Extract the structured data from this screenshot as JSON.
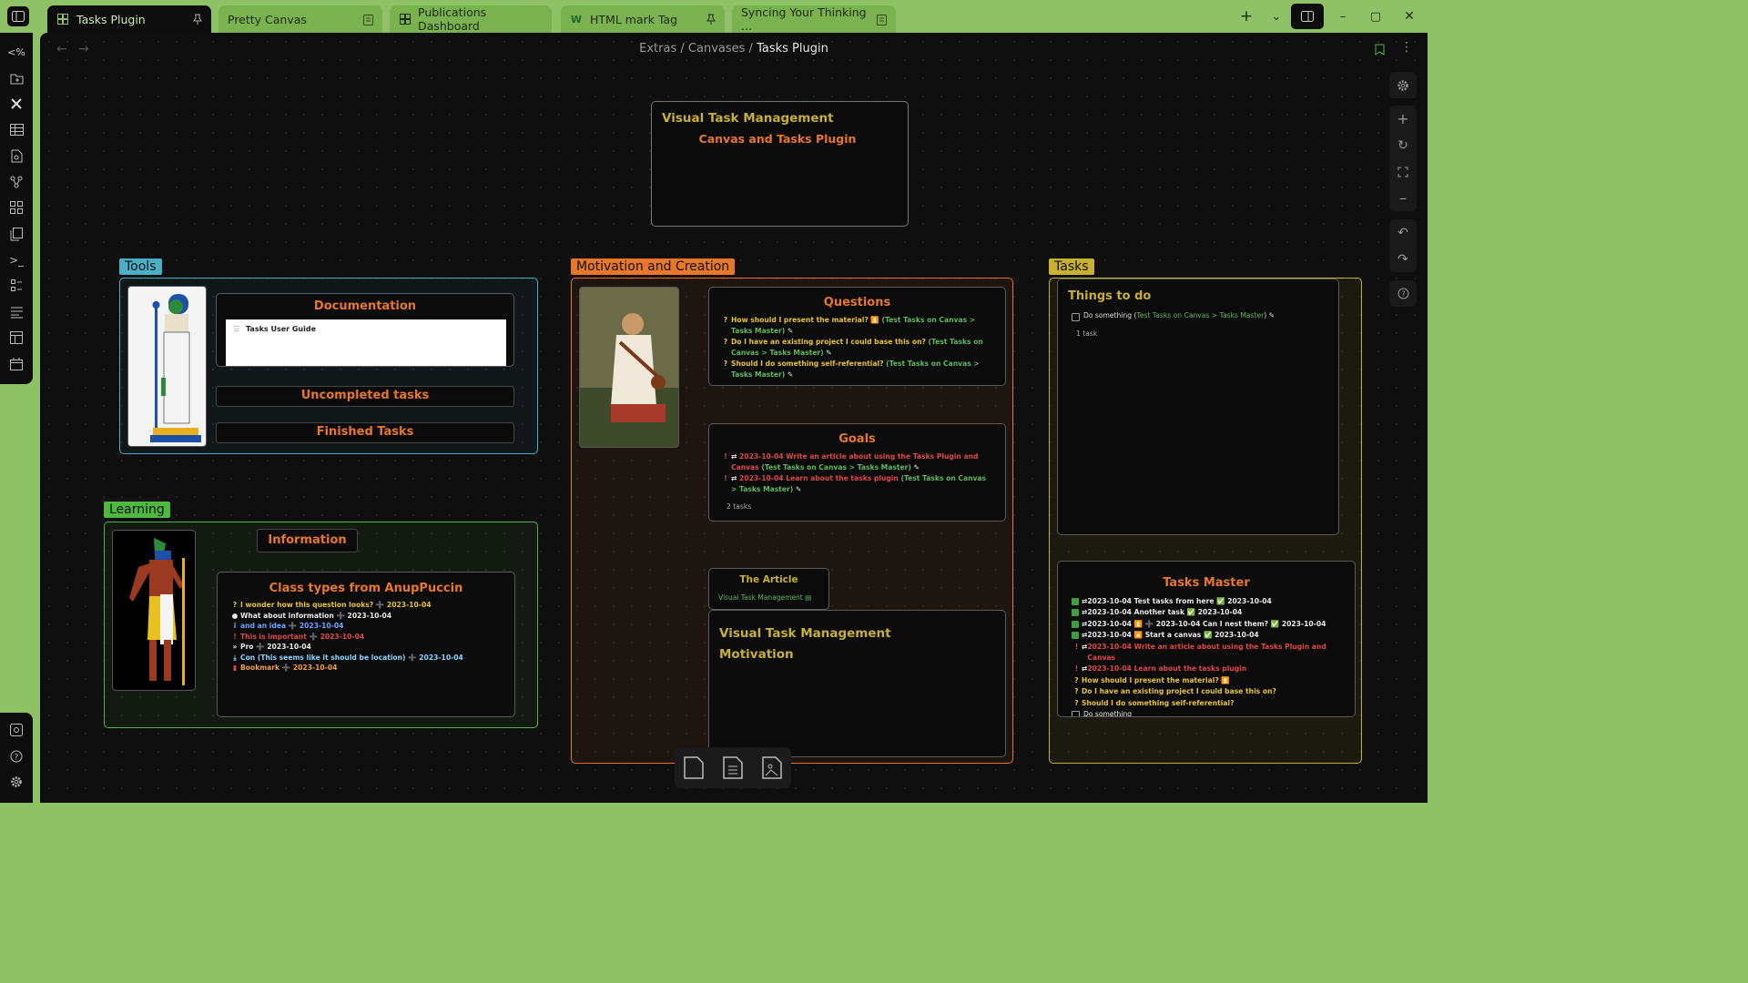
{
  "tabs": [
    {
      "label": "Tasks Plugin",
      "active": true,
      "pinned": true
    },
    {
      "label": "Pretty Canvas",
      "active": false
    },
    {
      "label": "Publications Dashboard",
      "active": false
    },
    {
      "label": "HTML mark Tag",
      "active": false,
      "pinned": true
    },
    {
      "label": "Syncing Your Thinking ...",
      "active": false
    }
  ],
  "breadcrumb": {
    "parts": [
      "Extras",
      "Canvases",
      "Tasks Plugin"
    ],
    "separator": "/"
  },
  "left_ribbon_top": [
    "percent-tag-icon",
    "open-folder-icon",
    "tools-icon",
    "table-icon",
    "file-search-icon",
    "graph-icon",
    "grid-icon",
    "files-icon",
    "terminal-icon",
    "list-icon",
    "sheet-icon",
    "layout-icon",
    "calendar-icon"
  ],
  "left_ribbon_bottom": [
    "vault-icon",
    "help-icon",
    "settings-icon"
  ],
  "canvas": {
    "title_card": {
      "title": "Visual Task Management",
      "subtitle": "Canvas and Tasks Plugin"
    },
    "tools": {
      "label": "Tools",
      "documentation": {
        "title": "Documentation",
        "embed_title": "Tasks User Guide"
      },
      "uncompleted": "Uncompleted tasks",
      "finished": "Finished Tasks"
    },
    "learning": {
      "label": "Learning",
      "information": "Information",
      "class_types": {
        "title": "Class types from AnupPuccin",
        "items": [
          {
            "icon": "?",
            "text": "I wonder how this question looks? ➕ 2023-10-04",
            "color": "yellow"
          },
          {
            "icon": "💡",
            "text": "What about information ➕ 2023-10-04",
            "color": "white"
          },
          {
            "icon": "i",
            "text": "and an idea ➕ 2023-10-04",
            "color": "blue"
          },
          {
            "icon": "!",
            "text": "This is important ➕ 2023-10-04",
            "color": "red"
          },
          {
            "icon": "»",
            "text": "Pro ➕ 2023-10-04",
            "color": "white"
          },
          {
            "icon": "⤓",
            "text": "Con (This seems like it should be location) ➕ 2023-10-04",
            "color": "lightblue"
          },
          {
            "icon": "🔖",
            "text": "Bookmark ➕ 2023-10-04",
            "color": "orange"
          }
        ]
      }
    },
    "motivation": {
      "label": "Motivation and Creation",
      "questions": {
        "title": "Questions",
        "items": [
          {
            "main": "How should I present the material? ⏫",
            "link": "(Test Tasks on Canvas > Tasks Master)"
          },
          {
            "main": "Do I have an existing project I could base this on?",
            "link": "(Test Tasks on Canvas > Tasks Master)"
          },
          {
            "main": "Should I do something self-referential?",
            "link": "(Test Tasks on Canvas > Tasks Master)"
          }
        ]
      },
      "goals": {
        "title": "Goals",
        "items": [
          {
            "main": "2023-10-04 Write an article about using the Tasks Plugin and Canvas",
            "link": "(Test Tasks on Canvas > Tasks Master)"
          },
          {
            "main": "2023-10-04 Learn about the tasks plugin",
            "link": "(Test Tasks on Canvas > Tasks Master)"
          }
        ],
        "count": "2 tasks"
      },
      "article": {
        "title": "The Article",
        "link": "Visual Task Management"
      },
      "vtm_motivation": {
        "line1": "Visual Task Management",
        "line2": "Motivation"
      }
    },
    "tasks": {
      "label": "Tasks",
      "things_to_do": {
        "title": "Things to do",
        "task": "Do something",
        "link": "Test Tasks on Canvas > Tasks Master",
        "count": "1 task"
      },
      "tasks_master": {
        "title": "Tasks Master",
        "items": [
          {
            "status": "done",
            "text": "2023-10-04 Test tasks from here ✅ 2023-10-04",
            "color": "white"
          },
          {
            "status": "done",
            "text": "2023-10-04 Another task ✅ 2023-10-04",
            "color": "white"
          },
          {
            "status": "done",
            "text": "2023-10-04 ⏫ ➕ 2023-10-04 Can I nest them? ✅ 2023-10-04",
            "color": "white"
          },
          {
            "status": "done",
            "text": "2023-10-04 🔼 Start a canvas ✅ 2023-10-04",
            "color": "white"
          },
          {
            "status": "important",
            "text": "2023-10-04 Write an article about using the Tasks Plugin and Canvas",
            "color": "red"
          },
          {
            "status": "important",
            "text": "2023-10-04 Learn about the tasks plugin",
            "color": "red"
          },
          {
            "status": "question",
            "text": "How should I present the material? ⏫",
            "color": "yellow"
          },
          {
            "status": "question",
            "text": "Do I have an existing project I could base this on?",
            "color": "yellow"
          },
          {
            "status": "question",
            "text": "Should I do something self-referential?",
            "color": "yellow"
          },
          {
            "status": "todo",
            "text": "Do something",
            "color": "white"
          }
        ]
      }
    }
  },
  "colors": {
    "tools": "#4ab0c8",
    "motivation": "#e8772a",
    "tasks": "#c8b030",
    "learning": "#4fb840"
  }
}
